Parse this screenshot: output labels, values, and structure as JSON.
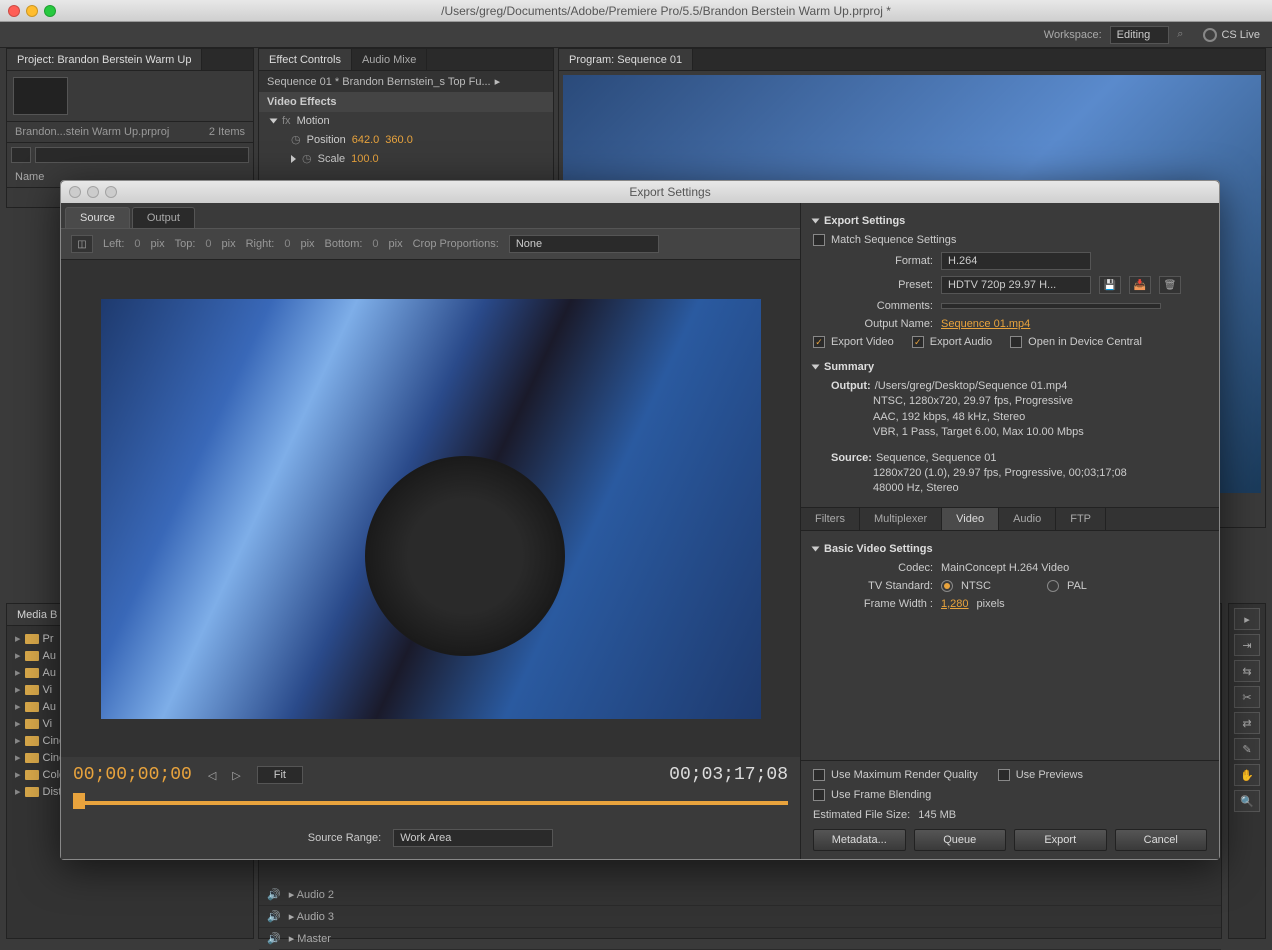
{
  "mac": {
    "title": "/Users/greg/Documents/Adobe/Premiere Pro/5.5/Brandon Berstein Warm Up.prproj *"
  },
  "workspace": {
    "label": "Workspace:",
    "value": "Editing",
    "cslive": "CS Live"
  },
  "project": {
    "tab": "Project: Brandon Berstein Warm Up",
    "footer_name": "Brandon...stein Warm Up.prproj",
    "footer_count": "2 Items",
    "name_header": "Name"
  },
  "effects": {
    "tab1": "Effect Controls",
    "tab2": "Audio Mixe",
    "seq": "Sequence 01 * Brandon Bernstein_s Top Fu...",
    "video_effects": "Video Effects",
    "motion": "Motion",
    "position": "Position",
    "pos_x": "642.0",
    "pos_y": "360.0",
    "scale": "Scale",
    "scale_val": "100.0"
  },
  "program": {
    "label": "Program: Sequence 01"
  },
  "export": {
    "title": "Export Settings",
    "tabs": {
      "source": "Source",
      "output": "Output"
    },
    "crop": {
      "left_l": "Left:",
      "left_v": "0",
      "left_u": "pix",
      "top_l": "Top:",
      "top_v": "0",
      "top_u": "pix",
      "right_l": "Right:",
      "right_v": "0",
      "right_u": "pix",
      "bottom_l": "Bottom:",
      "bottom_v": "0",
      "bottom_u": "pix",
      "prop_l": "Crop Proportions:",
      "prop_v": "None"
    },
    "tc_in": "00;00;00;00",
    "tc_out": "00;03;17;08",
    "fit": "Fit",
    "source_range_l": "Source Range:",
    "source_range_v": "Work Area",
    "settings_header": "Export Settings",
    "match": "Match Sequence Settings",
    "format_l": "Format:",
    "format_v": "H.264",
    "preset_l": "Preset:",
    "preset_v": "HDTV 720p 29.97 H...",
    "comments_l": "Comments:",
    "outputname_l": "Output Name:",
    "outputname_v": "Sequence 01.mp4",
    "export_video": "Export Video",
    "export_audio": "Export Audio",
    "open_device": "Open in Device Central",
    "summary_h": "Summary",
    "summary_out_l": "Output:",
    "summary_out": "/Users/greg/Desktop/Sequence 01.mp4\nNTSC, 1280x720, 29.97 fps, Progressive\nAAC, 192 kbps, 48 kHz, Stereo\nVBR, 1 Pass, Target 6.00, Max 10.00 Mbps",
    "summary_src_l": "Source:",
    "summary_src": "Sequence, Sequence 01\n1280x720 (1.0), 29.97 fps, Progressive, 00;03;17;08\n48000 Hz, Stereo",
    "subtabs": {
      "filters": "Filters",
      "multiplexer": "Multiplexer",
      "video": "Video",
      "audio": "Audio",
      "ftp": "FTP"
    },
    "bvs_header": "Basic Video Settings",
    "codec_l": "Codec:",
    "codec_v": "MainConcept H.264 Video",
    "tvstd_l": "TV Standard:",
    "tvstd_ntsc": "NTSC",
    "tvstd_pal": "PAL",
    "framew_l": "Frame Width :",
    "framew_v": "1,280",
    "framew_u": "pixels",
    "max_render": "Use Maximum Render Quality",
    "use_previews": "Use Previews",
    "frame_blend": "Use Frame Blending",
    "est_l": "Estimated File Size:",
    "est_v": "145 MB",
    "btn_meta": "Metadata...",
    "btn_queue": "Queue",
    "btn_export": "Export",
    "btn_cancel": "Cancel"
  },
  "media_browser": {
    "tab": "Media B"
  },
  "bins": {
    "items": [
      "Pr",
      "Au",
      "Au",
      "Vi",
      "Au",
      "Vi",
      "CineForm Color",
      "CineForm Noise Filters",
      "Color Correction",
      "Distort"
    ]
  },
  "timeline": {
    "tracks": [
      "Audio 2",
      "Audio 3",
      "Master"
    ]
  }
}
